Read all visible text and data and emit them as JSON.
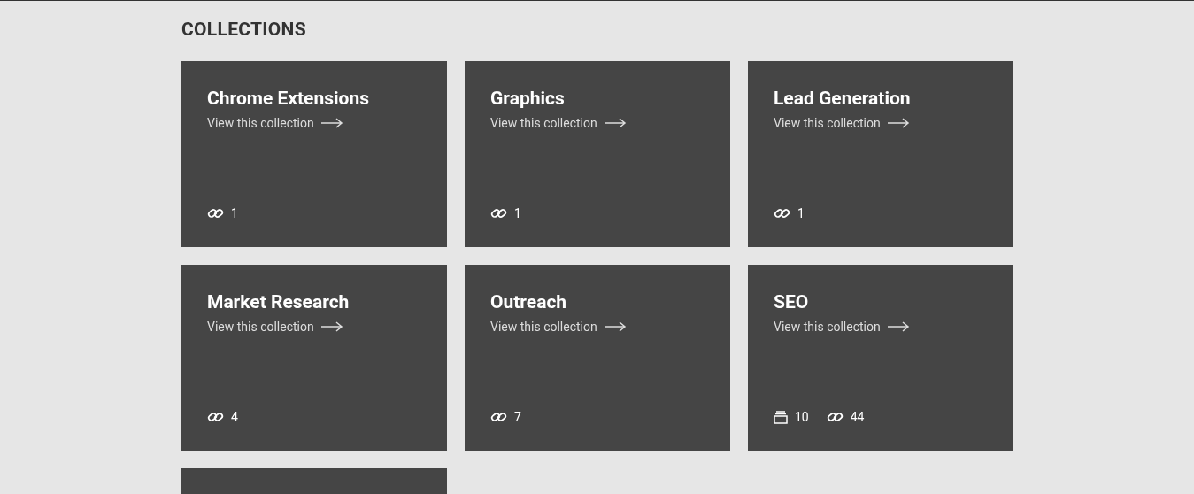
{
  "heading": "COLLECTIONS",
  "collections": [
    {
      "title": "Chrome Extensions",
      "link_text": "View this collection",
      "counts": [
        {
          "kind": "links",
          "value": "1"
        }
      ]
    },
    {
      "title": "Graphics",
      "link_text": "View this collection",
      "counts": [
        {
          "kind": "links",
          "value": "1"
        }
      ]
    },
    {
      "title": "Lead Generation",
      "link_text": "View this collection",
      "counts": [
        {
          "kind": "links",
          "value": "1"
        }
      ]
    },
    {
      "title": "Market Research",
      "link_text": "View this collection",
      "counts": [
        {
          "kind": "links",
          "value": "4"
        }
      ]
    },
    {
      "title": "Outreach",
      "link_text": "View this collection",
      "counts": [
        {
          "kind": "links",
          "value": "7"
        }
      ]
    },
    {
      "title": "SEO",
      "link_text": "View this collection",
      "counts": [
        {
          "kind": "stacks",
          "value": "10"
        },
        {
          "kind": "links",
          "value": "44"
        }
      ]
    },
    {
      "cut_off": true
    }
  ]
}
